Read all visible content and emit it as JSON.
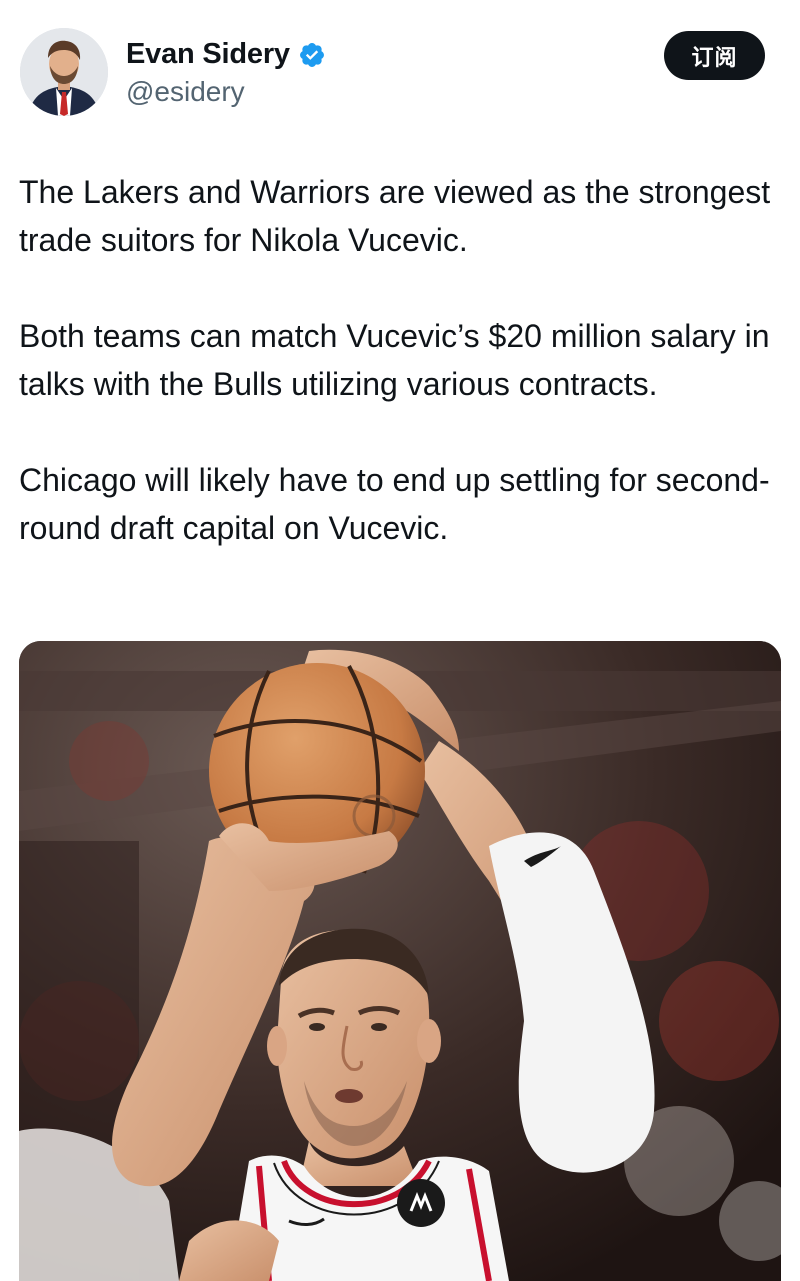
{
  "author": {
    "display_name": "Evan Sidery",
    "handle": "@esidery",
    "verified_icon": "verified-badge-icon",
    "verified_color": "#1d9bf0"
  },
  "actions": {
    "subscribe_label": "订阅"
  },
  "tweet": {
    "paragraphs": [
      "The Lakers and Warriors are viewed as the strongest trade suitors for Nikola Vucevic.",
      "Both teams can match Vucevic’s $20 million salary in talks with the Bulls utilizing various contracts.",
      "Chicago will likely have to end up settling for second-round draft capital on Vucevic."
    ]
  },
  "media": {
    "type": "photo",
    "subject_icon": "basketball-player-photo"
  },
  "colors": {
    "text_primary": "#0f1419",
    "text_secondary": "#536471",
    "button_bg": "#0f1419",
    "button_text": "#ffffff"
  }
}
